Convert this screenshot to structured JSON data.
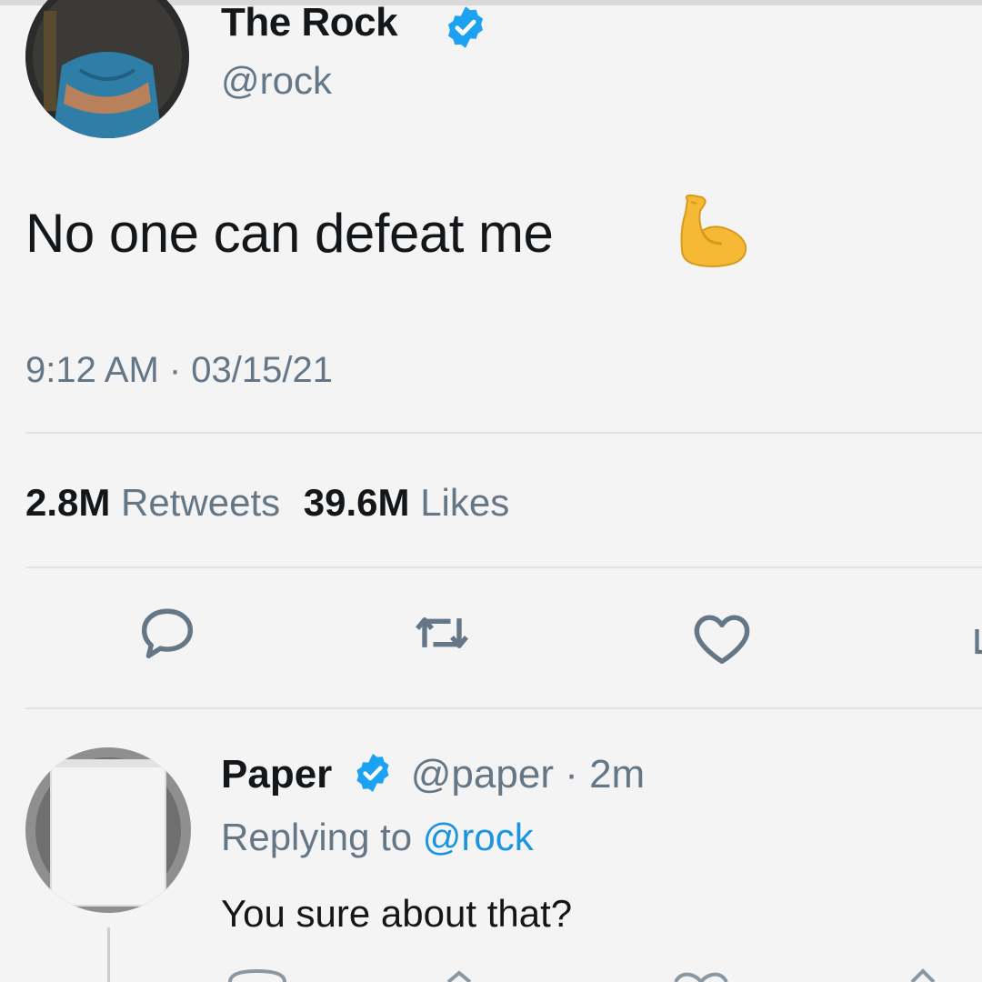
{
  "tweet": {
    "display_name": "The Rock",
    "handle": "@rock",
    "text": "No one can defeat me",
    "emoji": "flexed-biceps",
    "timestamp": "9:12 AM · 03/15/21",
    "retweets_count": "2.8M",
    "retweets_label": "Retweets",
    "likes_count": "39.6M",
    "likes_label": "Likes",
    "actions": [
      "reply-icon",
      "retweet-icon",
      "like-icon",
      "share-icon"
    ]
  },
  "reply": {
    "display_name": "Paper",
    "handle": "@paper",
    "separator": " · ",
    "age": "2m",
    "replying_prefix": "Replying to ",
    "replying_to": "@rock",
    "text": "You sure about that?"
  },
  "colors": {
    "verified": "#1da1f2",
    "mention": "#1b95e0",
    "secondary_text": "#657786",
    "primary_text": "#14171a",
    "emoji": "#f5b936"
  }
}
